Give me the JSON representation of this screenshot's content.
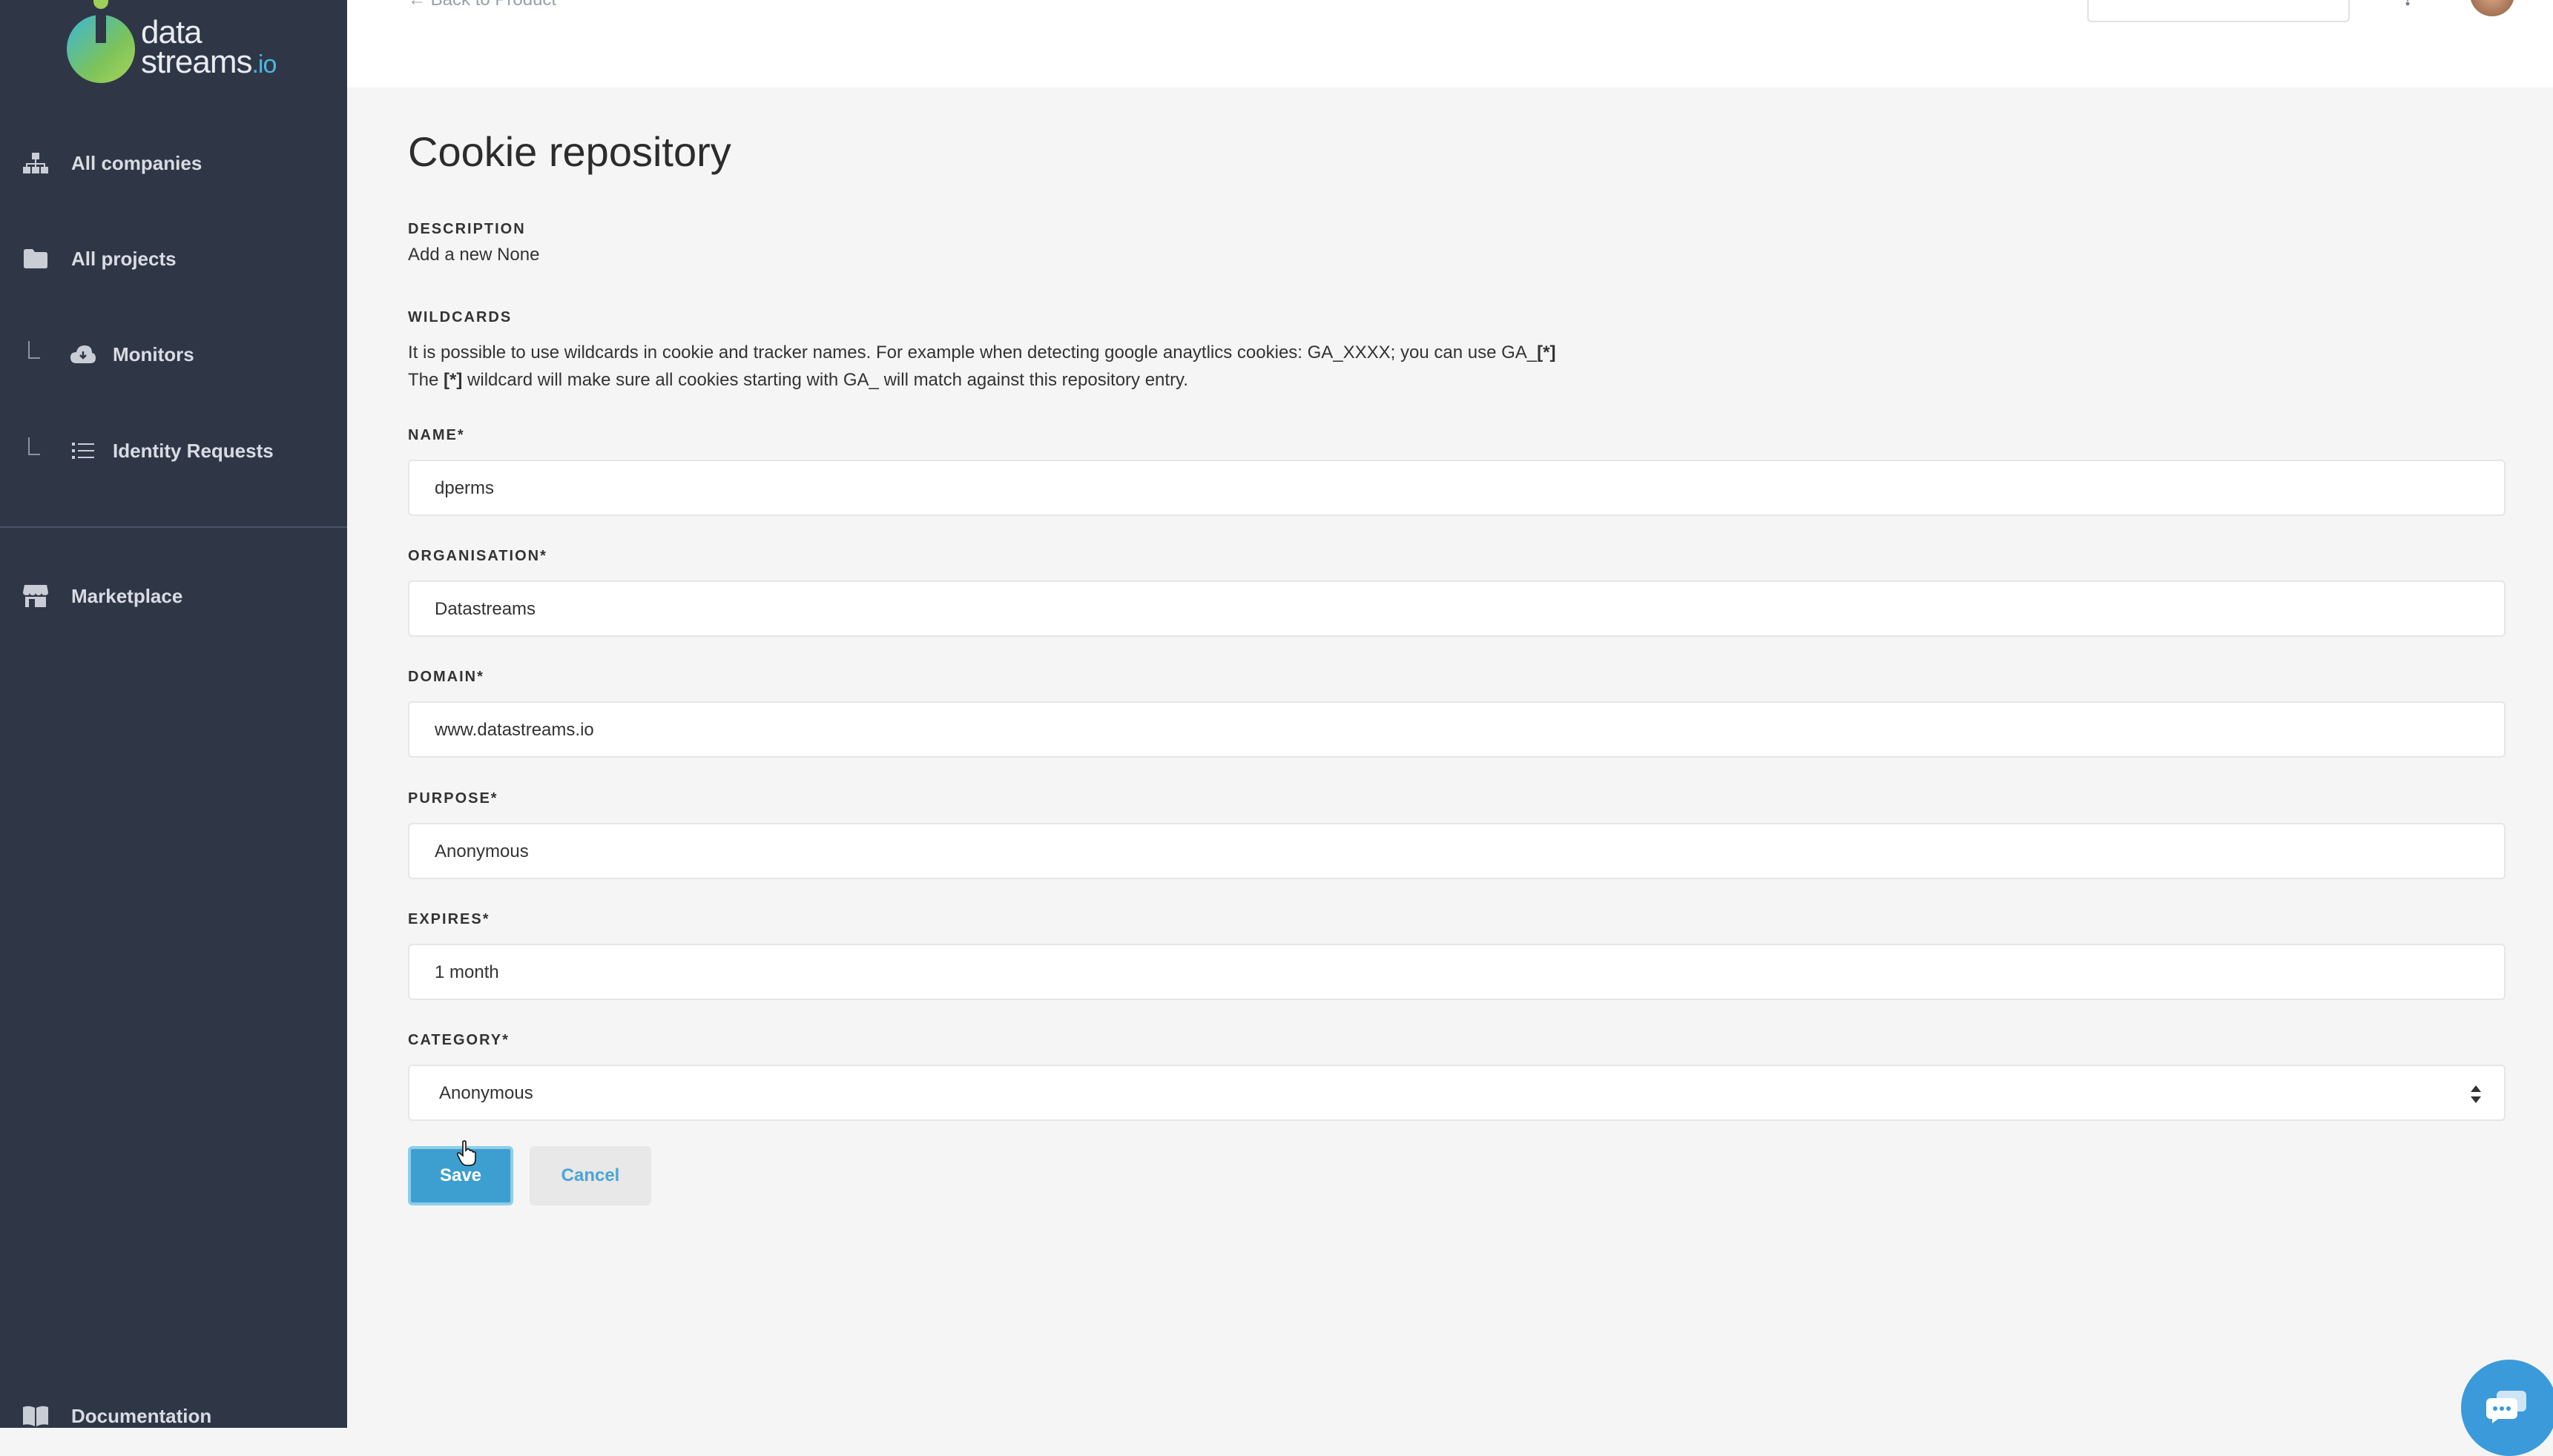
{
  "brand": {
    "logo_text_1": "data",
    "logo_text_2": "streams",
    "logo_text_3": ".io"
  },
  "sidebar": {
    "items": [
      {
        "label": "All companies",
        "icon": "sitemap-icon"
      },
      {
        "label": "All projects",
        "icon": "folder-icon"
      },
      {
        "label": "Monitors",
        "icon": "cloud-icon"
      },
      {
        "label": "Identity Requests",
        "icon": "list-icon"
      },
      {
        "label": "Marketplace",
        "icon": "store-icon"
      },
      {
        "label": "Documentation",
        "icon": "book-icon"
      }
    ]
  },
  "header": {
    "back_link": "← Back to Product"
  },
  "page": {
    "title": "Cookie repository",
    "description_label": "DESCRIPTION",
    "description_text": "Add a new None",
    "wildcards_label": "WILDCARDS",
    "wildcards_line1": "It is possible to use wildcards in cookie and tracker names. For example when detecting google anaytlics cookies: GA_XXXX; you can use GA_",
    "wildcards_line1_code": "[*]",
    "wildcards_line2_pre": "The ",
    "wildcards_line2_code": "[*]",
    "wildcards_line2_post": " wildcard will make sure all cookies starting with GA_ will match against this repository entry."
  },
  "form": {
    "name": {
      "label": "NAME*",
      "value": "dperms"
    },
    "organisation": {
      "label": "ORGANISATION*",
      "value": "Datastreams"
    },
    "domain": {
      "label": "DOMAIN*",
      "value": "www.datastreams.io"
    },
    "purpose": {
      "label": "PURPOSE*",
      "value": "Anonymous"
    },
    "expires": {
      "label": "EXPIRES*",
      "value": "1 month"
    },
    "category": {
      "label": "CATEGORY*",
      "value": "Anonymous"
    },
    "save_label": "Save",
    "cancel_label": "Cancel"
  },
  "colors": {
    "sidebar_bg": "#2f3747",
    "accent": "#3d9fd0"
  }
}
